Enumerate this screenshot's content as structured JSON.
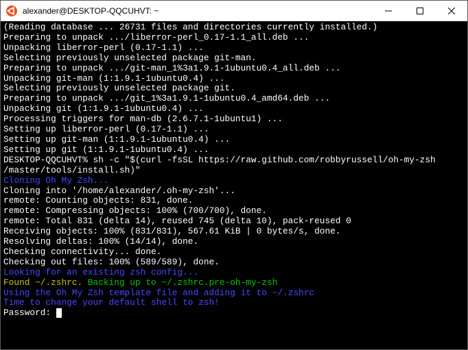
{
  "window": {
    "title": "alexander@DESKTOP-QQCUHVT: ~"
  },
  "terminal": {
    "lines": [
      {
        "cls": "c-white",
        "text": "(Reading database ... 26731 files and directories currently installed.)"
      },
      {
        "cls": "c-white",
        "text": "Preparing to unpack .../liberror-perl_0.17-1.1_all.deb ..."
      },
      {
        "cls": "c-white",
        "text": "Unpacking liberror-perl (0.17-1.1) ..."
      },
      {
        "cls": "c-white",
        "text": "Selecting previously unselected package git-man."
      },
      {
        "cls": "c-white",
        "text": "Preparing to unpack .../git-man_1%3a1.9.1-1ubuntu0.4_all.deb ..."
      },
      {
        "cls": "c-white",
        "text": "Unpacking git-man (1:1.9.1-1ubuntu0.4) ..."
      },
      {
        "cls": "c-white",
        "text": "Selecting previously unselected package git."
      },
      {
        "cls": "c-white",
        "text": "Preparing to unpack .../git_1%3a1.9.1-1ubuntu0.4_amd64.deb ..."
      },
      {
        "cls": "c-white",
        "text": "Unpacking git (1:1.9.1-1ubuntu0.4) ..."
      },
      {
        "cls": "c-white",
        "text": "Processing triggers for man-db (2.6.7.1-1ubuntu1) ..."
      },
      {
        "cls": "c-white",
        "text": "Setting up liberror-perl (0.17-1.1) ..."
      },
      {
        "cls": "c-white",
        "text": "Setting up git-man (1:1.9.1-1ubuntu0.4) ..."
      },
      {
        "cls": "c-white",
        "text": "Setting up git (1:1.9.1-1ubuntu0.4) ..."
      },
      {
        "cls": "c-white",
        "text": "DESKTOP-QQCUHVT% sh -c \"$(curl -fsSL https://raw.github.com/robbyrussell/oh-my-zsh"
      },
      {
        "cls": "c-white",
        "text": "/master/tools/install.sh)\""
      },
      {
        "cls": "c-blue",
        "text": "Cloning Oh My Zsh..."
      },
      {
        "cls": "c-white",
        "text": "Cloning into '/home/alexander/.oh-my-zsh'..."
      },
      {
        "cls": "c-white",
        "text": "remote: Counting objects: 831, done."
      },
      {
        "cls": "c-white",
        "text": "remote: Compressing objects: 100% (700/700), done."
      },
      {
        "cls": "c-white",
        "text": "remote: Total 831 (delta 14), reused 745 (delta 10), pack-reused 0"
      },
      {
        "cls": "c-white",
        "text": "Receiving objects: 100% (831/831), 567.61 KiB | 0 bytes/s, done."
      },
      {
        "cls": "c-white",
        "text": "Resolving deltas: 100% (14/14), done."
      },
      {
        "cls": "c-white",
        "text": "Checking connectivity... done."
      },
      {
        "cls": "c-white",
        "text": "Checking out files: 100% (589/589), done."
      },
      {
        "cls": "c-blue",
        "text": "Looking for an existing zsh config..."
      },
      {
        "cls": "",
        "segments": [
          {
            "cls": "c-yellow",
            "text": "Found ~/.zshrc. "
          },
          {
            "cls": "c-green",
            "text": "Backing up to ~/.zshrc.pre-oh-my-zsh"
          }
        ]
      },
      {
        "cls": "c-blue",
        "text": "Using the Oh My Zsh template file and adding it to ~/.zshrc"
      },
      {
        "cls": "c-blue",
        "text": "Time to change your default shell to zsh!"
      },
      {
        "cls": "c-white",
        "text": "Password:",
        "cursor": true
      }
    ]
  }
}
